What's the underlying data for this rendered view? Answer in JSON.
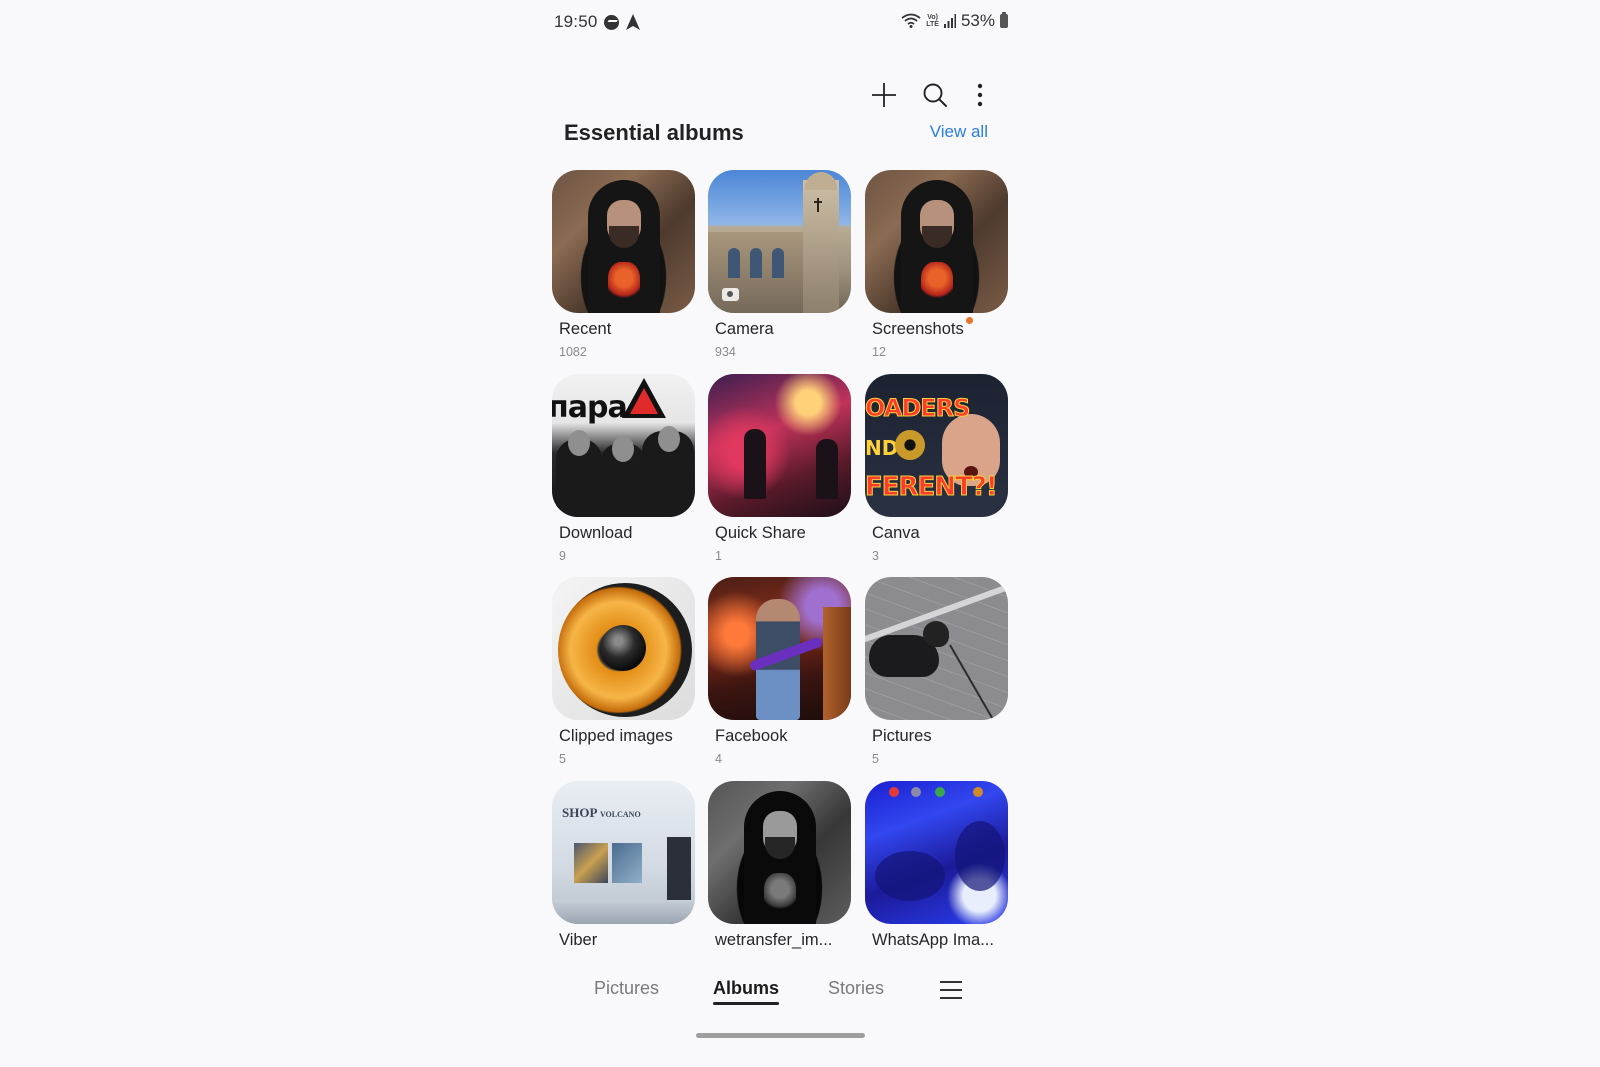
{
  "status_bar": {
    "time": "19:50",
    "left_icons": [
      "messenger-icon",
      "navigation-arrow-icon"
    ],
    "right_icons": [
      "wifi-icon",
      "volte-icon",
      "signal-icon",
      "battery-icon"
    ],
    "volte_line1": "Vo)",
    "volte_line2": "LTE",
    "battery": "53%"
  },
  "toolbar": {
    "actions": [
      {
        "name": "add",
        "icon": "plus-icon"
      },
      {
        "name": "search",
        "icon": "search-icon"
      },
      {
        "name": "more-options",
        "icon": "more-vertical-icon"
      }
    ]
  },
  "section": {
    "title": "Essential albums",
    "view_all": "View all"
  },
  "albums": [
    {
      "name": "Recent",
      "count": "1082",
      "new_indicator": false
    },
    {
      "name": "Camera",
      "count": "934",
      "new_indicator": false,
      "badge": "camera-icon"
    },
    {
      "name": "Screenshots",
      "count": "12",
      "new_indicator": true
    },
    {
      "name": "Download",
      "count": "9",
      "new_indicator": false
    },
    {
      "name": "Quick Share",
      "count": "1",
      "new_indicator": false
    },
    {
      "name": "Canva",
      "count": "3",
      "new_indicator": false
    },
    {
      "name": "Clipped images",
      "count": "5",
      "new_indicator": false
    },
    {
      "name": "Facebook",
      "count": "4",
      "new_indicator": false
    },
    {
      "name": "Pictures",
      "count": "5",
      "new_indicator": false
    },
    {
      "name": "Viber",
      "count": "",
      "new_indicator": false
    },
    {
      "name": "wetransfer_im...",
      "count": "",
      "new_indicator": false
    },
    {
      "name": "WhatsApp Ima...",
      "count": "",
      "new_indicator": false
    }
  ],
  "thumb_text": {
    "download_logo": "пара",
    "canva_line1": "OADERS",
    "canva_line2": "ND",
    "canva_line3": "FERENT?!",
    "viber_sign": "SHOP",
    "viber_sign_small": "VOLCANO"
  },
  "bottom_nav": {
    "tabs": [
      {
        "label": "Pictures",
        "active": false
      },
      {
        "label": "Albums",
        "active": true
      },
      {
        "label": "Stories",
        "active": false
      }
    ],
    "menu_icon": "hamburger-menu-icon"
  },
  "colors": {
    "background": "#f9f9fb",
    "accent_link": "#2a7ee0",
    "new_dot": "#e8742a",
    "active_tab": "#1c1c1c",
    "inactive_tab": "#7a7a7a"
  }
}
